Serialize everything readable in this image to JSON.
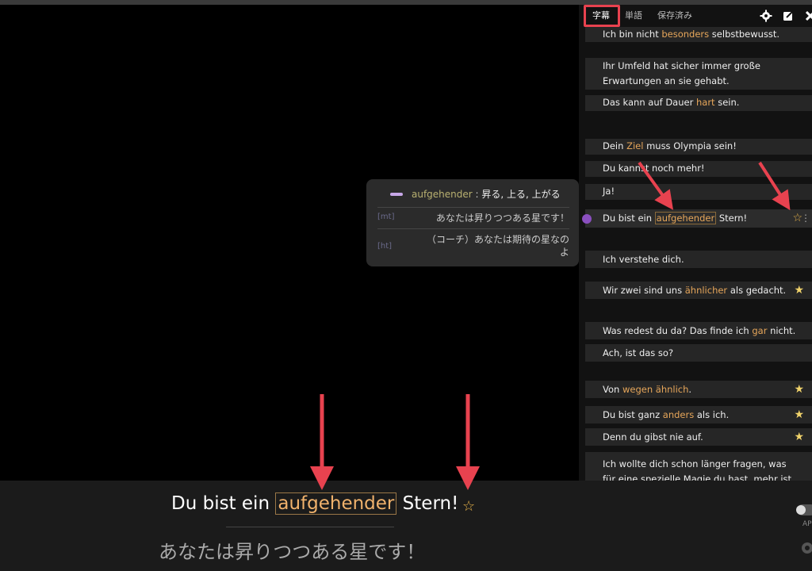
{
  "tabs": {
    "subtitles": "字幕",
    "words": "単語",
    "saved": "保存済み"
  },
  "subtitle_list": [
    {
      "pre": "Ich bin nicht ",
      "hl": "besonders",
      "post": " selbstbewusst.",
      "star": "none"
    },
    {
      "line1": "Ihr Umfeld hat sicher immer große",
      "line2": "Erwartungen an sie gehabt.",
      "star": "none"
    },
    {
      "pre": "Das kann auf Dauer ",
      "hl": "hart",
      "post": " sein.",
      "star": "none"
    },
    {
      "pre": "Dein ",
      "hl": "Ziel",
      "post": " muss Olympia sein!",
      "star": "none"
    },
    {
      "pre": "Du kannst noch mehr!",
      "hl": "",
      "post": "",
      "star": "none"
    },
    {
      "pre": "Ja!",
      "hl": "",
      "post": "",
      "star": "none"
    },
    {
      "pre": "Du bist ein ",
      "hl": "aufgehender",
      "post": " Stern!",
      "star": "empty",
      "active": true
    },
    {
      "pre": "Ich verstehe dich.",
      "hl": "",
      "post": "",
      "star": "none"
    },
    {
      "pre": "Wir zwei sind uns ",
      "hl": "ähnlicher",
      "post": " als gedacht.",
      "star": "full"
    },
    {
      "pre": "Was redest du da? Das finde ich ",
      "hl": "gar",
      "post": " nicht.",
      "star": "none"
    },
    {
      "pre": "Ach, ist das so?",
      "hl": "",
      "post": "",
      "star": "none"
    },
    {
      "pre": "Von ",
      "hl": "wegen ähnlich",
      "post": ".",
      "star": "full"
    },
    {
      "pre": "Du bist ganz ",
      "hl": "anders",
      "post": " als ich.",
      "star": "full"
    },
    {
      "pre": "Denn du gibst nie auf.",
      "hl": "",
      "post": "",
      "star": "full"
    },
    {
      "line1": "Ich wollte dich schon länger fragen, was",
      "line2": "für eine spezielle Magie du hast, mehr ist",
      "star": "none"
    }
  ],
  "popup": {
    "word": "aufgehender",
    "separator": " : ",
    "meaning": "昇る, 上る, 上がる",
    "mt_tag": "[mt]",
    "mt_text": "あなたは昇りつつある星です！",
    "ht_tag": "[ht]",
    "ht_text_1": "（コーチ）あなたは期待の星なの",
    "ht_text_2": "よ"
  },
  "bottom_subtitle": {
    "pre": "Du bist ein ",
    "hl": "aufgehender",
    "post": " Stern!",
    "star": "☆",
    "translation": "あなたは昇りつつある星です！",
    "toggle_label": "AP"
  },
  "icons": [
    "gear-icon",
    "export-icon",
    "close-icon",
    "star-icon",
    "play-icon",
    "more-vertical-icon",
    "settings-icon"
  ],
  "colors": {
    "highlight": "#e6a65a",
    "tab_highlight_box": "#e8424f",
    "arrow": "#e8424f",
    "star": "#f1d36b"
  }
}
